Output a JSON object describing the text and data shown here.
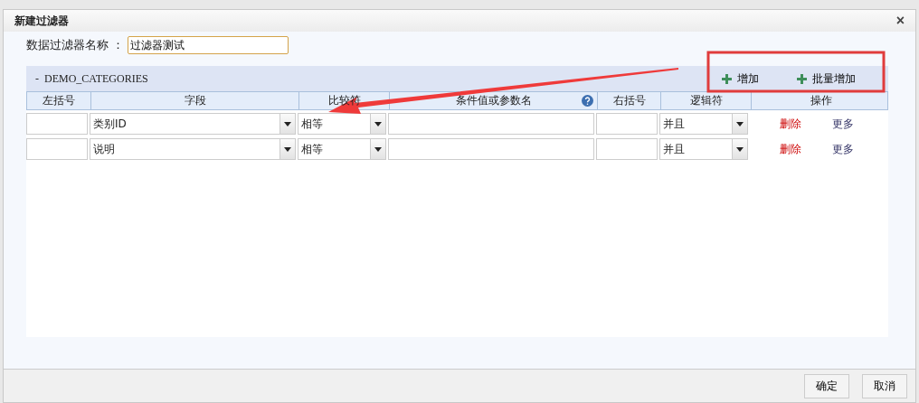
{
  "dialog": {
    "title": "新建过滤器",
    "close": "×"
  },
  "name_field": {
    "label": "数据过滤器名称 ：",
    "value": "过滤器测试"
  },
  "group": {
    "toggle": "-",
    "title": "DEMO_CATEGORIES",
    "actions": [
      "增加",
      "批量增加"
    ]
  },
  "table": {
    "columns": [
      {
        "label": "左括号",
        "help": false
      },
      {
        "label": "字段",
        "help": false
      },
      {
        "label": "比较符",
        "help": false
      },
      {
        "label": "条件值或参数名",
        "help": true
      },
      {
        "label": "右括号",
        "help": false
      },
      {
        "label": "逻辑符",
        "help": false
      },
      {
        "label": "操作",
        "help": false
      }
    ],
    "rows": [
      {
        "left_paren": "",
        "field": "类别ID",
        "operator": "相等",
        "value": "",
        "right_paren": "",
        "logic": "并且",
        "delete": "删除",
        "more": "更多"
      },
      {
        "left_paren": "",
        "field": "说明",
        "operator": "相等",
        "value": "",
        "right_paren": "",
        "logic": "并且",
        "delete": "删除",
        "more": "更多"
      }
    ]
  },
  "buttons": [
    "确定",
    "取消"
  ]
}
